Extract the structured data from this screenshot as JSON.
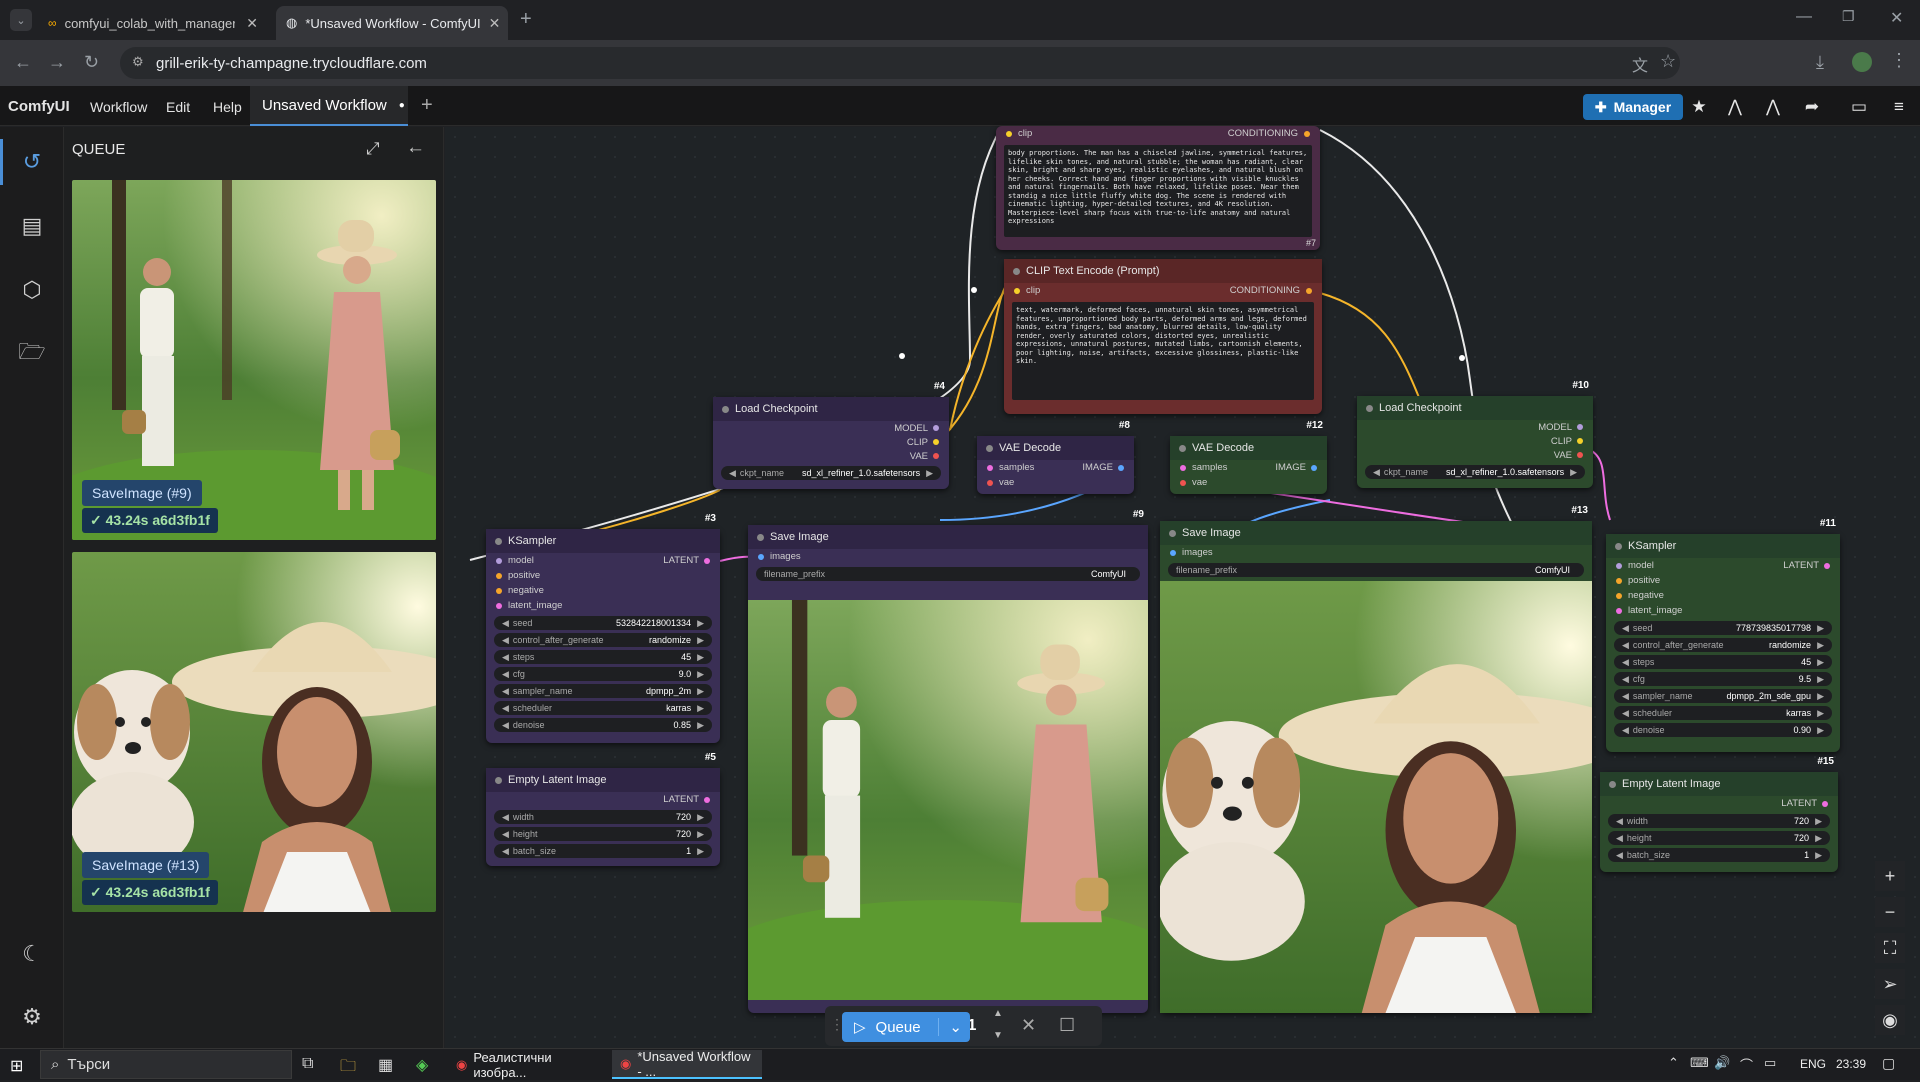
{
  "browser": {
    "tabs": [
      {
        "label": "comfyui_colab_with_manager.ip"
      },
      {
        "label": "*Unsaved Workflow - ComfyUI"
      }
    ],
    "url": "grill-erik-ty-champagne.trycloudflare.com"
  },
  "menu": {
    "brand": "ComfyUI",
    "items": [
      "Workflow",
      "Edit",
      "Help"
    ],
    "workflow_tab": "Unsaved Workflow",
    "manager_label": "Manager"
  },
  "queue_panel": {
    "title": "QUEUE",
    "items": [
      {
        "label": "SaveImage (#9)",
        "status": "43.24s a6d3fb1f"
      },
      {
        "label": "SaveImage (#13)",
        "status": "43.24s a6d3fb1f"
      }
    ]
  },
  "nodes": {
    "clip_pos": {
      "in_label": "clip",
      "out_label": "CONDITIONING",
      "text": "body proportions. The man has a chiseled jawline, symmetrical features, lifelike skin tones, and natural stubble; the woman has radiant, clear skin, bright and sharp eyes, realistic eyelashes, and natural blush on her cheeks. Correct hand and finger proportions with visible knuckles and natural fingernails. Both have relaxed, lifelike poses. Near them standig a nice little fluffy white dog. The scene is rendered with cinematic lighting, hyper-detailed textures, and 4K resolution. Masterpiece-level sharp focus with true-to-life anatomy and natural expressions",
      "id": "#7"
    },
    "clip_neg": {
      "title": "CLIP Text Encode (Prompt)",
      "in_label": "clip",
      "out_label": "CONDITIONING",
      "text": "text, watermark, deformed faces, unnatural skin tones, asymmetrical features, unproportioned body parts, deformed arms and legs, deformed hands, extra fingers, bad anatomy, blurred details, low-quality render, overly saturated colors, distorted eyes, unrealistic expressions, unnatural postures, mutated limbs, cartoonish elements, poor lighting, noise, artifacts, excessive glossiness, plastic-like skin."
    },
    "load_ckpt_1": {
      "title": "Load Checkpoint",
      "id": "#4",
      "outputs": [
        "MODEL",
        "CLIP",
        "VAE"
      ],
      "widget_name": "ckpt_name",
      "widget_value": "sd_xl_refiner_1.0.safetensors"
    },
    "load_ckpt_2": {
      "title": "Load Checkpoint",
      "id": "#10",
      "outputs": [
        "MODEL",
        "CLIP",
        "VAE"
      ],
      "widget_name": "ckpt_name",
      "widget_value": "sd_xl_refiner_1.0.safetensors"
    },
    "vae_1": {
      "title": "VAE Decode",
      "id": "#8",
      "in1": "samples",
      "in2": "vae",
      "out": "IMAGE"
    },
    "vae_2": {
      "title": "VAE Decode",
      "id": "#12",
      "in1": "samples",
      "in2": "vae",
      "out": "IMAGE"
    },
    "ksampler_1": {
      "title": "KSampler",
      "id": "#3",
      "inputs": [
        "model",
        "positive",
        "negative",
        "latent_image"
      ],
      "out": "LATENT",
      "widgets": [
        {
          "name": "seed",
          "value": "532842218001334"
        },
        {
          "name": "control_after_generate",
          "value": "randomize"
        },
        {
          "name": "steps",
          "value": "45"
        },
        {
          "name": "cfg",
          "value": "9.0"
        },
        {
          "name": "sampler_name",
          "value": "dpmpp_2m"
        },
        {
          "name": "scheduler",
          "value": "karras"
        },
        {
          "name": "denoise",
          "value": "0.85"
        }
      ]
    },
    "ksampler_2": {
      "title": "KSampler",
      "id": "#11",
      "inputs": [
        "model",
        "positive",
        "negative",
        "latent_image"
      ],
      "out": "LATENT",
      "widgets": [
        {
          "name": "seed",
          "value": "778739835017798"
        },
        {
          "name": "control_after_generate",
          "value": "randomize"
        },
        {
          "name": "steps",
          "value": "45"
        },
        {
          "name": "cfg",
          "value": "9.5"
        },
        {
          "name": "sampler_name",
          "value": "dpmpp_2m_sde_gpu"
        },
        {
          "name": "scheduler",
          "value": "karras"
        },
        {
          "name": "denoise",
          "value": "0.90"
        }
      ]
    },
    "latent_1": {
      "title": "Empty Latent Image",
      "id": "#5",
      "out": "LATENT",
      "widgets": [
        {
          "name": "width",
          "value": "720"
        },
        {
          "name": "height",
          "value": "720"
        },
        {
          "name": "batch_size",
          "value": "1"
        }
      ]
    },
    "latent_2": {
      "title": "Empty Latent Image",
      "id": "#15",
      "out": "LATENT",
      "widgets": [
        {
          "name": "width",
          "value": "720"
        },
        {
          "name": "height",
          "value": "720"
        },
        {
          "name": "batch_size",
          "value": "1"
        }
      ]
    },
    "save_1": {
      "title": "Save Image",
      "id": "#9",
      "in": "images",
      "widget_name": "filename_prefix",
      "widget_value": "ComfyUI"
    },
    "save_2": {
      "title": "Save Image",
      "id": "#13",
      "in": "images",
      "widget_name": "filename_prefix",
      "widget_value": "ComfyUI"
    }
  },
  "runbar": {
    "queue_label": "Queue",
    "count": "1"
  },
  "taskbar": {
    "search": "Търси",
    "apps": [
      "Реалистични изобра...",
      "*Unsaved Workflow - ..."
    ],
    "lang": "ENG",
    "time": "23:39"
  }
}
